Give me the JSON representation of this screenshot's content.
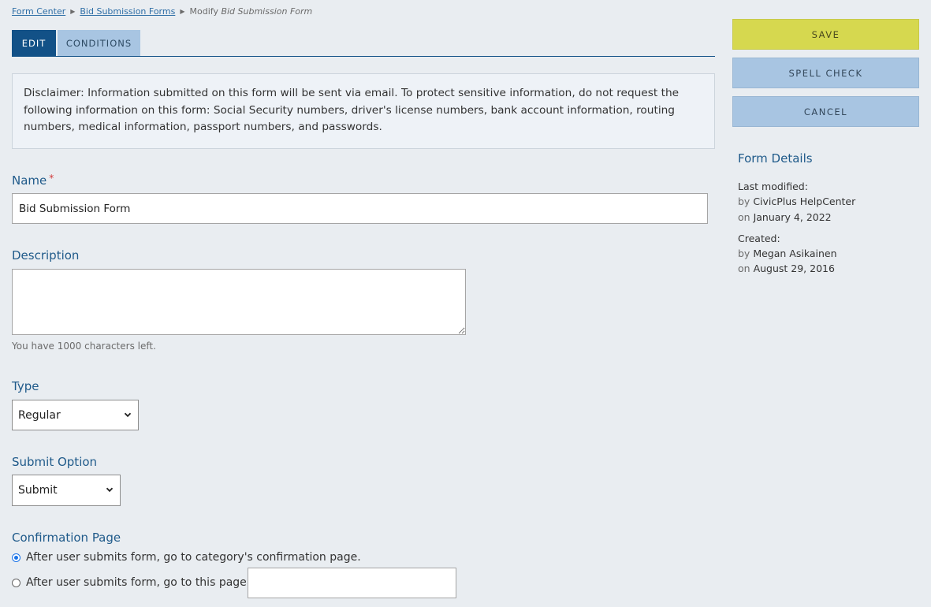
{
  "breadcrumb": {
    "item1": "Form Center",
    "item2": "Bid Submission Forms",
    "current_prefix": "Modify",
    "current_name": "Bid Submission Form"
  },
  "tabs": {
    "edit": "EDIT",
    "conditions": "CONDITIONS"
  },
  "disclaimer": "Disclaimer: Information submitted on this form will be sent via email. To protect sensitive information, do not request the following information on this form: Social Security numbers, driver's license numbers, bank account information, routing numbers, medical information, passport numbers, and passwords.",
  "form": {
    "name_label": "Name",
    "required_mark": "*",
    "name_value": "Bid Submission Form",
    "description_label": "Description",
    "description_value": "",
    "char_hint": "You have 1000 characters left.",
    "type_label": "Type",
    "type_value": "Regular",
    "submit_label": "Submit Option",
    "submit_value": "Submit",
    "confirmation_label": "Confirmation Page",
    "confirm_option1": "After user submits form, go to category's confirmation page.",
    "confirm_option2": "After user submits form, go to this page:",
    "confirm_page_value": ""
  },
  "actions": {
    "save": "SAVE",
    "spell_check": "SPELL CHECK",
    "cancel": "CANCEL"
  },
  "details": {
    "title": "Form Details",
    "last_modified_label": "Last modified:",
    "by": "by",
    "on": "on",
    "modified_by": "CivicPlus HelpCenter",
    "modified_on": "January 4, 2022",
    "created_label": "Created:",
    "created_by": "Megan Asikainen",
    "created_on": "August 29, 2016"
  },
  "colors": {
    "tab_active": "#125187",
    "tab_inactive": "#a8c5e2",
    "save": "#d6d84f",
    "heading": "#1f5a8a",
    "background": "#e9edf1"
  }
}
